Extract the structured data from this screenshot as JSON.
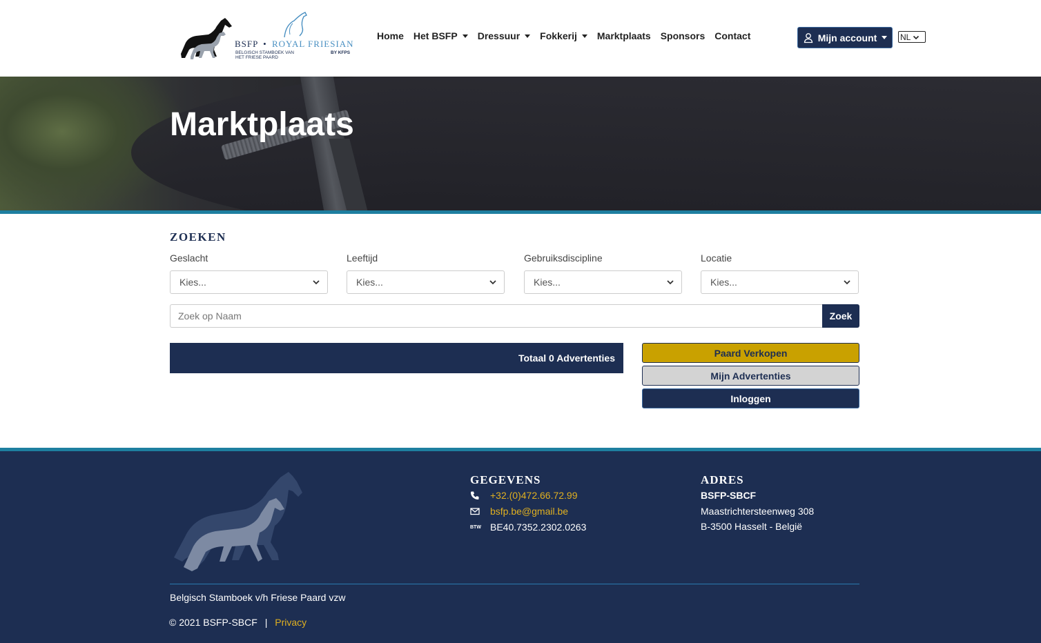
{
  "header": {
    "logo": {
      "brand_left": "BSFP",
      "brand_dot": "•",
      "brand_right": "ROYAL FRIESIAN",
      "tagline_line1": "BELGISCH STAMBOEK VAN",
      "tagline_line2": "HET FRIESE PAARD",
      "tagline_right": "BY KFPS"
    },
    "nav": [
      {
        "label": "Home",
        "dropdown": false
      },
      {
        "label": "Het BSFP",
        "dropdown": true
      },
      {
        "label": "Dressuur",
        "dropdown": true
      },
      {
        "label": "Fokkerij",
        "dropdown": true
      },
      {
        "label": "Marktplaats",
        "dropdown": false
      },
      {
        "label": "Sponsors",
        "dropdown": false
      },
      {
        "label": "Contact",
        "dropdown": false
      }
    ],
    "account_label": "Mijn account",
    "language": "NL"
  },
  "hero": {
    "title": "Marktplaats"
  },
  "search": {
    "title": "ZOEKEN",
    "filters": [
      {
        "label": "Geslacht",
        "value": "Kies..."
      },
      {
        "label": "Leeftijd",
        "value": "Kies..."
      },
      {
        "label": "Gebruiksdiscipline",
        "value": "Kies..."
      },
      {
        "label": "Locatie",
        "value": "Kies..."
      }
    ],
    "name_placeholder": "Zoek op Naam",
    "search_button": "Zoek"
  },
  "results": {
    "total_label": "Totaal 0 Advertenties"
  },
  "actions": {
    "sell_horse": "Paard Verkopen",
    "my_ads": "Mijn Advertenties",
    "login": "Inloggen"
  },
  "colors": {
    "navy": "#1d2e52",
    "accent_blue": "#1e7fa0",
    "gold": "#c9a100",
    "link_gold": "#e0b020"
  },
  "footer": {
    "contact_title": "GEGEVENS",
    "phone": "+32.(0)472.66.72.99",
    "email": "bsfp.be@gmail.be",
    "btw_label": "BTW",
    "btw_value": "BE40.7352.2302.0263",
    "address_title": "ADRES",
    "address_lines": [
      "BSFP-SBCF",
      "Maastrichtersteenweg 308",
      "B-3500 Hasselt - België"
    ],
    "org_name": "Belgisch Stamboek v/h Friese Paard vzw",
    "copyright": "© 2021 BSFP-SBCF",
    "separator": "|",
    "privacy_link": "Privacy"
  }
}
